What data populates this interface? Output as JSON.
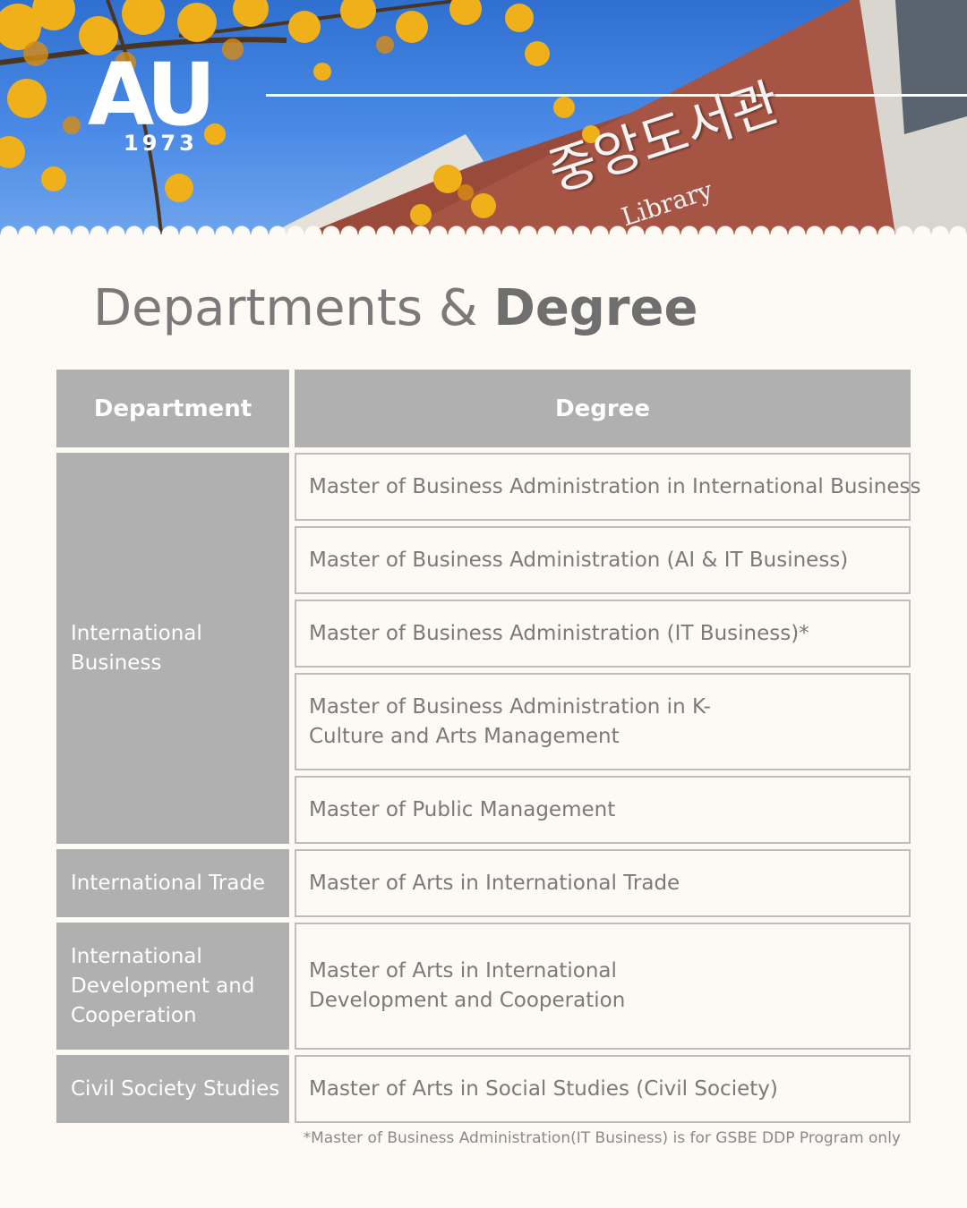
{
  "hero": {
    "logo": "AU",
    "year": "1973",
    "sign_korean": "중앙도서관",
    "sign_english": "Library"
  },
  "title": {
    "light": "Departments &",
    "bold": "Degree"
  },
  "table": {
    "headers": {
      "department": "Department",
      "degree": "Degree"
    },
    "departments": [
      "International Business",
      "International Trade",
      "International Development and Cooperation",
      "Civil Society Studies"
    ],
    "degrees": [
      "Master of Business Administration in International Business",
      "Master of Business Administration (AI & IT Business)",
      "Master of Business Administration (IT Business)*",
      "Master of Business Administration in K-Culture and Arts Management",
      "Master of Public Management",
      "Master of Arts in International Trade",
      "Master of Arts in International Development and Cooperation",
      "Master of Arts in Social Studies (Civil Society)"
    ]
  },
  "footnote": "*Master of Business Administration(IT Business) is for GSBE DDP Program only"
}
